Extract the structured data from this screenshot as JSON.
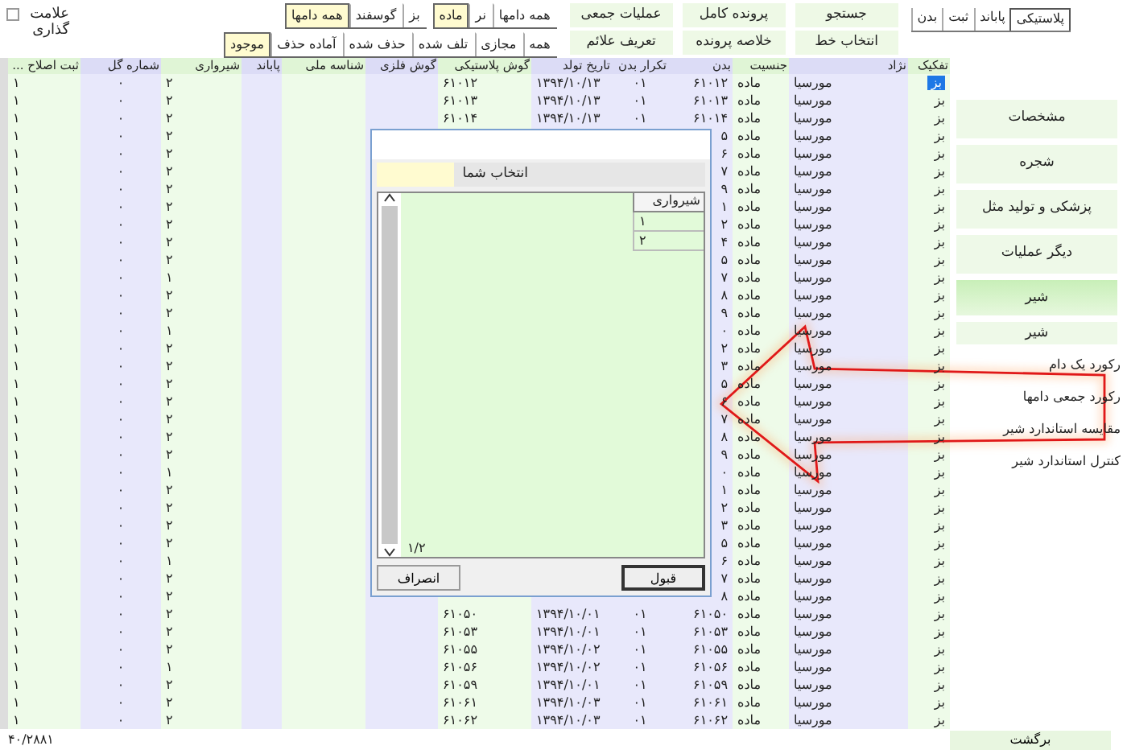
{
  "mark_option": {
    "label": "علامت گذاری",
    "checked": false
  },
  "filters": [
    [
      {
        "label": "همه دامها",
        "selected": false
      },
      {
        "label": "نر",
        "selected": false
      },
      {
        "label": "ماده",
        "selected": true
      }
    ],
    [
      {
        "label": "بز",
        "selected": false
      },
      {
        "label": "گوسفند",
        "selected": false
      },
      {
        "label": "همه دامها",
        "selected": true
      }
    ],
    [
      {
        "label": "همه",
        "selected": false
      },
      {
        "label": "مجازی",
        "selected": false
      },
      {
        "label": "تلف شده",
        "selected": false
      },
      {
        "label": "حذف شده",
        "selected": false
      },
      {
        "label": "آماده حذف",
        "selected": false
      },
      {
        "label": "موجود",
        "selected": true
      }
    ]
  ],
  "actions": [
    [
      "جستجو",
      "پرونده کامل",
      "عملیات جمعی"
    ],
    [
      "انتخاب خط",
      "خلاصه پرونده",
      "تعریف علائم"
    ]
  ],
  "tabs": [
    {
      "label": "پلاستیکی",
      "selected": true
    },
    {
      "label": "پاباند",
      "selected": false
    },
    {
      "label": "ثبت",
      "selected": false
    },
    {
      "label": "بدن",
      "selected": false
    }
  ],
  "table": {
    "columns": [
      "تفکیک",
      "نژاد",
      "جنسیت",
      "بدن",
      "تکرار بدن",
      "تاریخ تولد",
      "گوش پلاستیکی",
      "گوش فلزی",
      "شناسه ملی",
      "پاباند",
      "شیرواری",
      "شماره گل",
      "ثبت اصلاح ..."
    ],
    "rows": [
      {
        "selected": true,
        "cells": [
          "بز",
          "مورسیا",
          "ماده",
          "۶۱۰۱۲",
          "۰۱",
          "۱۳۹۴/۱۰/۱۳",
          "۶۱۰۱۲",
          null,
          null,
          null,
          "۲",
          "۰",
          "۱"
        ]
      },
      {
        "selected": false,
        "cells": [
          "بز",
          "مورسیا",
          "ماده",
          "۶۱۰۱۳",
          "۰۱",
          "۱۳۹۴/۱۰/۱۳",
          "۶۱۰۱۳",
          null,
          null,
          null,
          "۲",
          "۰",
          "۱"
        ]
      },
      {
        "selected": false,
        "cells": [
          "بز",
          "مورسیا",
          "ماده",
          "۶۱۰۱۴",
          "۰۱",
          "۱۳۹۴/۱۰/۱۳",
          "۶۱۰۱۴",
          null,
          null,
          null,
          "۲",
          "۰",
          "۱"
        ]
      },
      {
        "selected": false,
        "cells": [
          "بز",
          "مورسیا",
          "ماده",
          "۵",
          null,
          null,
          null,
          null,
          null,
          null,
          "۲",
          "۰",
          "۱"
        ]
      },
      {
        "selected": false,
        "cells": [
          "بز",
          "مورسیا",
          "ماده",
          "۶",
          null,
          null,
          null,
          null,
          null,
          null,
          "۲",
          "۰",
          "۱"
        ]
      },
      {
        "selected": false,
        "cells": [
          "بز",
          "مورسیا",
          "ماده",
          "۷",
          null,
          null,
          null,
          null,
          null,
          null,
          "۲",
          "۰",
          "۱"
        ]
      },
      {
        "selected": false,
        "cells": [
          "بز",
          "مورسیا",
          "ماده",
          "۹",
          null,
          null,
          null,
          null,
          null,
          null,
          "۲",
          "۰",
          "۱"
        ]
      },
      {
        "selected": false,
        "cells": [
          "بز",
          "مورسیا",
          "ماده",
          "۱",
          null,
          null,
          null,
          null,
          null,
          null,
          "۲",
          "۰",
          "۱"
        ]
      },
      {
        "selected": false,
        "cells": [
          "بز",
          "مورسیا",
          "ماده",
          "۲",
          null,
          null,
          null,
          null,
          null,
          null,
          "۲",
          "۰",
          "۱"
        ]
      },
      {
        "selected": false,
        "cells": [
          "بز",
          "مورسیا",
          "ماده",
          "۴",
          null,
          null,
          null,
          null,
          null,
          null,
          "۲",
          "۰",
          "۱"
        ]
      },
      {
        "selected": false,
        "cells": [
          "بز",
          "مورسیا",
          "ماده",
          "۵",
          null,
          null,
          null,
          null,
          null,
          null,
          "۲",
          "۰",
          "۱"
        ]
      },
      {
        "selected": false,
        "cells": [
          "بز",
          "مورسیا",
          "ماده",
          "۷",
          null,
          null,
          null,
          null,
          null,
          null,
          "۱",
          "۰",
          "۱"
        ]
      },
      {
        "selected": false,
        "cells": [
          "بز",
          "مورسیا",
          "ماده",
          "۸",
          null,
          null,
          null,
          null,
          null,
          null,
          "۲",
          "۰",
          "۱"
        ]
      },
      {
        "selected": false,
        "cells": [
          "بز",
          "مورسیا",
          "ماده",
          "۹",
          null,
          null,
          null,
          null,
          null,
          null,
          "۲",
          "۰",
          "۱"
        ]
      },
      {
        "selected": false,
        "cells": [
          "بز",
          "مورسیا",
          "ماده",
          "۰",
          null,
          null,
          null,
          null,
          null,
          null,
          "۱",
          "۰",
          "۱"
        ]
      },
      {
        "selected": false,
        "cells": [
          "بز",
          "مورسیا",
          "ماده",
          "۲",
          null,
          null,
          null,
          null,
          null,
          null,
          "۲",
          "۰",
          "۱"
        ]
      },
      {
        "selected": false,
        "cells": [
          "بز",
          "مورسیا",
          "ماده",
          "۳",
          null,
          null,
          null,
          null,
          null,
          null,
          "۲",
          "۰",
          "۱"
        ]
      },
      {
        "selected": false,
        "cells": [
          "بز",
          "مورسیا",
          "ماده",
          "۵",
          null,
          null,
          null,
          null,
          null,
          null,
          "۲",
          "۰",
          "۱"
        ]
      },
      {
        "selected": false,
        "cells": [
          "بز",
          "مورسیا",
          "ماده",
          "۶",
          null,
          null,
          null,
          null,
          null,
          null,
          "۲",
          "۰",
          "۱"
        ]
      },
      {
        "selected": false,
        "cells": [
          "بز",
          "مورسیا",
          "ماده",
          "۷",
          null,
          null,
          null,
          null,
          null,
          null,
          "۲",
          "۰",
          "۱"
        ]
      },
      {
        "selected": false,
        "cells": [
          "بز",
          "مورسیا",
          "ماده",
          "۸",
          null,
          null,
          null,
          null,
          null,
          null,
          "۲",
          "۰",
          "۱"
        ]
      },
      {
        "selected": false,
        "cells": [
          "بز",
          "مورسیا",
          "ماده",
          "۹",
          null,
          null,
          null,
          null,
          null,
          null,
          "۲",
          "۰",
          "۱"
        ]
      },
      {
        "selected": false,
        "cells": [
          "بز",
          "مورسیا",
          "ماده",
          "۰",
          null,
          null,
          null,
          null,
          null,
          null,
          "۱",
          "۰",
          "۱"
        ]
      },
      {
        "selected": false,
        "cells": [
          "بز",
          "مورسیا",
          "ماده",
          "۱",
          null,
          null,
          null,
          null,
          null,
          null,
          "۲",
          "۰",
          "۱"
        ]
      },
      {
        "selected": false,
        "cells": [
          "بز",
          "مورسیا",
          "ماده",
          "۲",
          null,
          null,
          null,
          null,
          null,
          null,
          "۲",
          "۰",
          "۱"
        ]
      },
      {
        "selected": false,
        "cells": [
          "بز",
          "مورسیا",
          "ماده",
          "۳",
          null,
          null,
          null,
          null,
          null,
          null,
          "۲",
          "۰",
          "۱"
        ]
      },
      {
        "selected": false,
        "cells": [
          "بز",
          "مورسیا",
          "ماده",
          "۵",
          null,
          null,
          null,
          null,
          null,
          null,
          "۲",
          "۰",
          "۱"
        ]
      },
      {
        "selected": false,
        "cells": [
          "بز",
          "مورسیا",
          "ماده",
          "۶",
          null,
          null,
          null,
          null,
          null,
          null,
          "۱",
          "۰",
          "۱"
        ]
      },
      {
        "selected": false,
        "cells": [
          "بز",
          "مورسیا",
          "ماده",
          "۷",
          null,
          null,
          null,
          null,
          null,
          null,
          "۲",
          "۰",
          "۱"
        ]
      },
      {
        "selected": false,
        "cells": [
          "بز",
          "مورسیا",
          "ماده",
          "۸",
          null,
          null,
          null,
          null,
          null,
          null,
          "۲",
          "۰",
          "۱"
        ]
      },
      {
        "selected": false,
        "cells": [
          "بز",
          "مورسیا",
          "ماده",
          "۶۱۰۵۰",
          "۰۱",
          "۱۳۹۴/۱۰/۰۱",
          "۶۱۰۵۰",
          null,
          null,
          null,
          "۲",
          "۰",
          "۱"
        ]
      },
      {
        "selected": false,
        "cells": [
          "بز",
          "مورسیا",
          "ماده",
          "۶۱۰۵۳",
          "۰۱",
          "۱۳۹۴/۱۰/۰۱",
          "۶۱۰۵۳",
          null,
          null,
          null,
          "۲",
          "۰",
          "۱"
        ]
      },
      {
        "selected": false,
        "cells": [
          "بز",
          "مورسیا",
          "ماده",
          "۶۱۰۵۵",
          "۰۱",
          "۱۳۹۴/۱۰/۰۲",
          "۶۱۰۵۵",
          null,
          null,
          null,
          "۲",
          "۰",
          "۱"
        ]
      },
      {
        "selected": false,
        "cells": [
          "بز",
          "مورسیا",
          "ماده",
          "۶۱۰۵۶",
          "۰۱",
          "۱۳۹۴/۱۰/۰۲",
          "۶۱۰۵۶",
          null,
          null,
          null,
          "۱",
          "۰",
          "۱"
        ]
      },
      {
        "selected": false,
        "cells": [
          "بز",
          "مورسیا",
          "ماده",
          "۶۱۰۵۹",
          "۰۱",
          "۱۳۹۴/۱۰/۰۱",
          "۶۱۰۵۹",
          null,
          null,
          null,
          "۲",
          "۰",
          "۱"
        ]
      },
      {
        "selected": false,
        "cells": [
          "بز",
          "مورسیا",
          "ماده",
          "۶۱۰۶۱",
          "۰۱",
          "۱۳۹۴/۱۰/۰۳",
          "۶۱۰۶۱",
          null,
          null,
          null,
          "۲",
          "۰",
          "۱"
        ]
      },
      {
        "selected": false,
        "cells": [
          "بز",
          "مورسیا",
          "ماده",
          "۶۱۰۶۲",
          "۰۱",
          "۱۳۹۴/۱۰/۰۳",
          "۶۱۰۶۲",
          null,
          null,
          null,
          "۲",
          "۰",
          "۱"
        ]
      }
    ]
  },
  "dialog": {
    "choice_label": "انتخاب شما",
    "list_header": "شیرواری",
    "options": [
      "۱",
      "۲"
    ],
    "pager": "۱/۲",
    "buttons": [
      "قبول",
      "انصراف"
    ]
  },
  "sidebar": [
    {
      "kind": "section",
      "label": "مشخصات",
      "selected": false
    },
    {
      "kind": "section",
      "label": "شجره",
      "selected": false
    },
    {
      "kind": "section",
      "label": "پزشکی و تولید مثل",
      "selected": false
    },
    {
      "kind": "section",
      "label": "دیگر عملیات",
      "selected": false
    },
    {
      "kind": "section",
      "label": "شیر",
      "selected": true
    },
    {
      "kind": "heading",
      "label": "شیر"
    },
    {
      "kind": "link",
      "label": "رکورد یک دام"
    },
    {
      "kind": "link",
      "label": "رکورد جمعی دامها"
    },
    {
      "kind": "link",
      "label": "مقایسه استاندارد شیر"
    },
    {
      "kind": "link",
      "label": "کنترل استاندارد شیر"
    }
  ],
  "footer": {
    "count": "۴۰/۲۸۸۱",
    "back_button": "برگشت"
  }
}
